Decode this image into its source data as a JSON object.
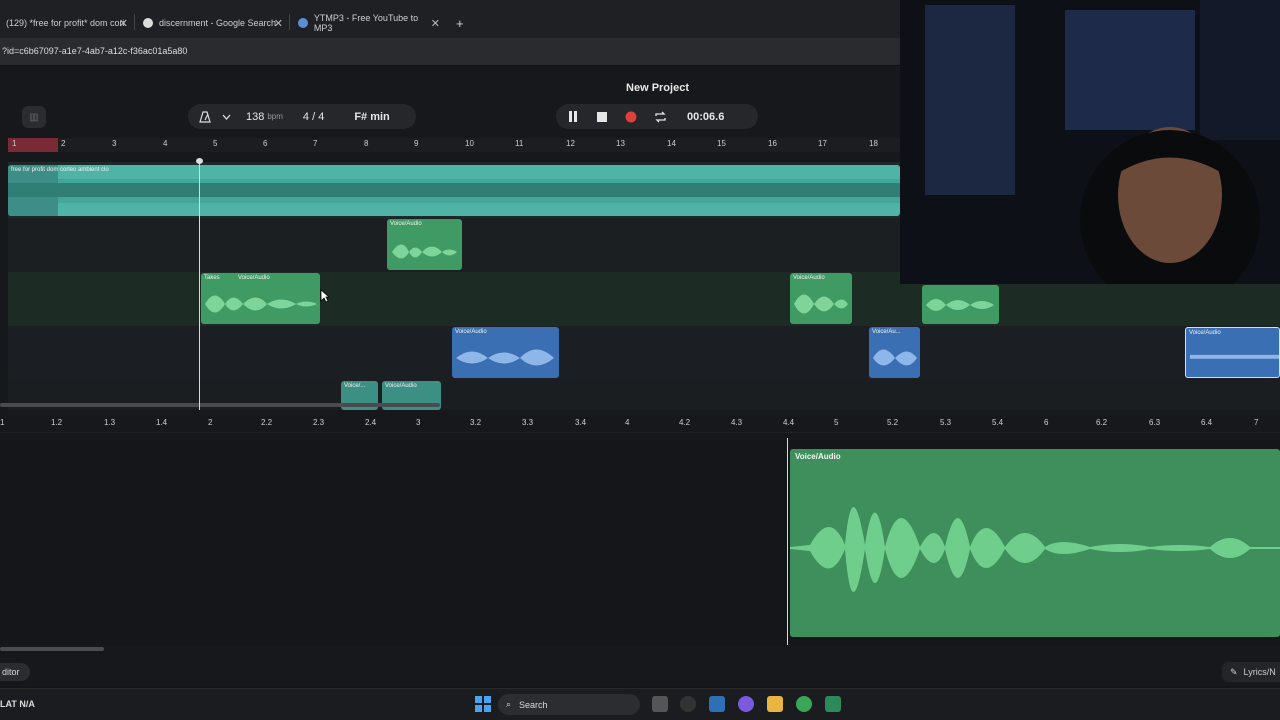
{
  "browser": {
    "tabs": [
      {
        "title": "(129) *free for profit* dom cori",
        "close": "✕"
      },
      {
        "title": "discernment - Google Search",
        "close": "✕"
      },
      {
        "title": "YTMP3 - Free YouTube to MP3",
        "close": "✕"
      }
    ],
    "new_tab": "+",
    "url": "?id=c6b67097-a1e7-4ab7-a12c-f36ac01a5a80"
  },
  "project": {
    "title": "New Project",
    "bpm_value": "138",
    "bpm_unit": "bpm",
    "time_signature": "4 / 4",
    "key": "F# min",
    "time": "00:06.6"
  },
  "ruler_top": [
    "1",
    "2",
    "3",
    "4",
    "5",
    "6",
    "7",
    "8",
    "9",
    "10",
    "11",
    "12",
    "13",
    "14",
    "15",
    "16",
    "17",
    "18"
  ],
  "tracks": {
    "beat_label": "free for profit dom corleo  ambient  clo",
    "clip_label": "Voice/Audio",
    "clip_label_short": "Voice/...",
    "clip_label_trunc": "Voice/Au...",
    "takes_label": "Takes"
  },
  "ruler_bottom": [
    "1",
    "1.2",
    "1.3",
    "1.4",
    "2",
    "2.2",
    "2.3",
    "2.4",
    "3",
    "3.2",
    "3.3",
    "3.4",
    "4",
    "4.2",
    "4.3",
    "4.4",
    "5",
    "5.2",
    "5.3",
    "5.4",
    "6",
    "6.2",
    "6.3",
    "6.4",
    "7"
  ],
  "editor": {
    "clip_label": "Voice/Audio",
    "tab_label": "ditor",
    "lyrics_label": "Lyrics/N"
  },
  "taskbar": {
    "weather": "LAT  N/A",
    "search_placeholder": "Search"
  },
  "colors": {
    "beat_track": "#4fb3a6",
    "voice_green": "#3f9a63",
    "voice_blue": "#3a6fb3",
    "record": "#e0403a"
  }
}
